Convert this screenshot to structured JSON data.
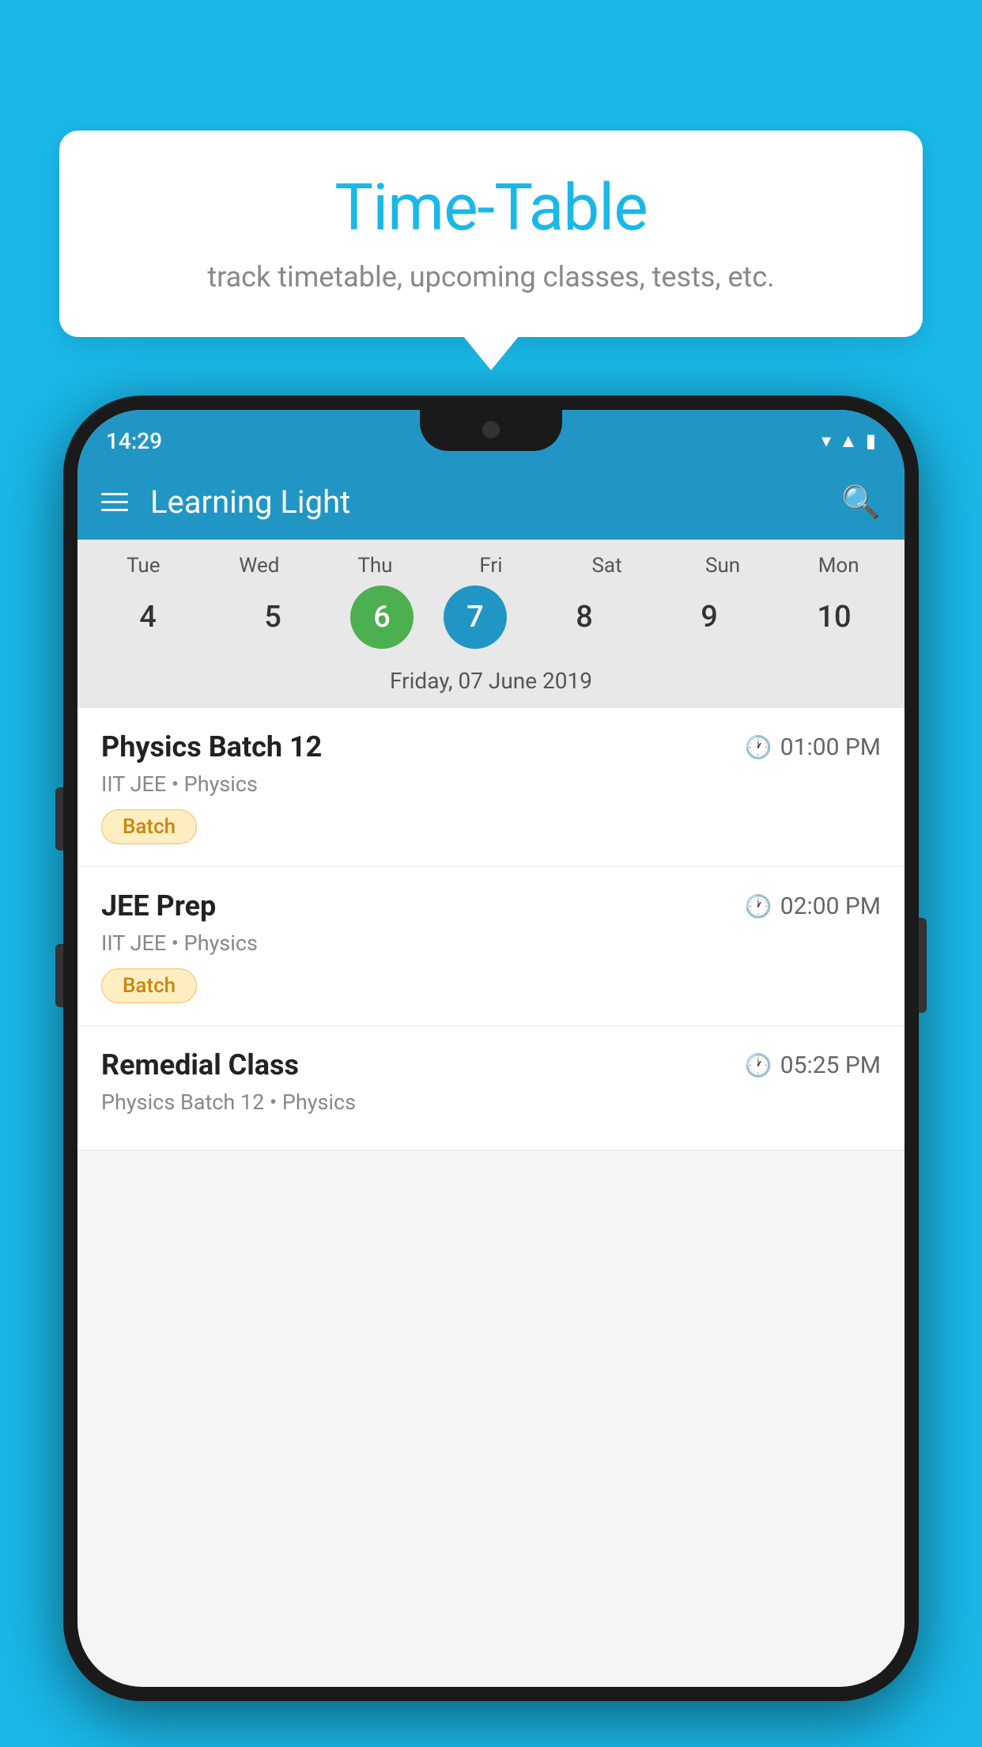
{
  "background_color": "#1ab8e8",
  "tooltip": {
    "title": "Time-Table",
    "subtitle": "track timetable, upcoming classes, tests, etc."
  },
  "phone": {
    "status_bar": {
      "time": "14:29",
      "icons": [
        "wifi",
        "signal",
        "battery"
      ]
    },
    "app_bar": {
      "title": "Learning Light",
      "menu_label": "Menu",
      "search_label": "Search"
    },
    "calendar": {
      "days": [
        {
          "label": "Tue",
          "num": "4"
        },
        {
          "label": "Wed",
          "num": "5"
        },
        {
          "label": "Thu",
          "num": "6",
          "state": "today"
        },
        {
          "label": "Fri",
          "num": "7",
          "state": "selected"
        },
        {
          "label": "Sat",
          "num": "8"
        },
        {
          "label": "Sun",
          "num": "9"
        },
        {
          "label": "Mon",
          "num": "10"
        }
      ],
      "selected_date_label": "Friday, 07 June 2019"
    },
    "schedule": [
      {
        "name": "Physics Batch 12",
        "time": "01:00 PM",
        "meta": "IIT JEE • Physics",
        "badge": "Batch"
      },
      {
        "name": "JEE Prep",
        "time": "02:00 PM",
        "meta": "IIT JEE • Physics",
        "badge": "Batch"
      },
      {
        "name": "Remedial Class",
        "time": "05:25 PM",
        "meta": "Physics Batch 12 • Physics",
        "badge": null
      }
    ]
  }
}
